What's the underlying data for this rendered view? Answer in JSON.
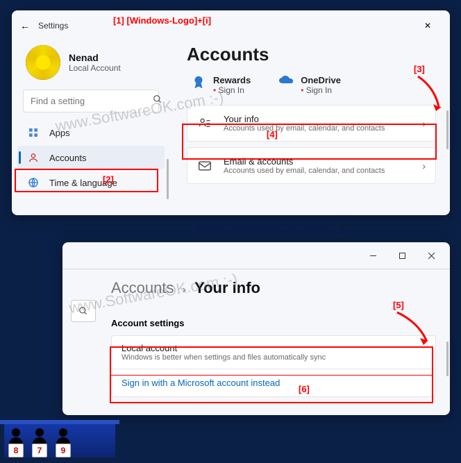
{
  "window1": {
    "title": "Settings",
    "user": {
      "name": "Nenad",
      "account_type": "Local Account"
    },
    "search": {
      "placeholder": "Find a setting"
    },
    "nav": {
      "apps": "Apps",
      "accounts": "Accounts",
      "time": "Time & language"
    },
    "heading": "Accounts",
    "rewards": {
      "title": "Rewards",
      "sub": "Sign In"
    },
    "onedrive": {
      "title": "OneDrive",
      "sub": "Sign In"
    },
    "your_info": {
      "title": "Your info",
      "sub": "Accounts used by email, calendar, and contacts"
    },
    "email": {
      "title": "Email & accounts",
      "sub": "Accounts used by email, calendar, and contacts"
    }
  },
  "window2": {
    "crumb_parent": "Accounts",
    "crumb_current": "Your info",
    "section": "Account settings",
    "local": {
      "title": "Local account",
      "sub": "Windows is better when settings and files automatically sync"
    },
    "link": "Sign in with a Microsoft account instead"
  },
  "annotations": {
    "a1": "[1] [Windows-Logo]+[i]",
    "a2": "[2]",
    "a3": "[3]",
    "a4": "[4]",
    "a5": "[5]",
    "a6": "[6]"
  },
  "watermark": "www.SoftwareOK.com :-)",
  "judges": [
    "8",
    "7",
    "9"
  ]
}
